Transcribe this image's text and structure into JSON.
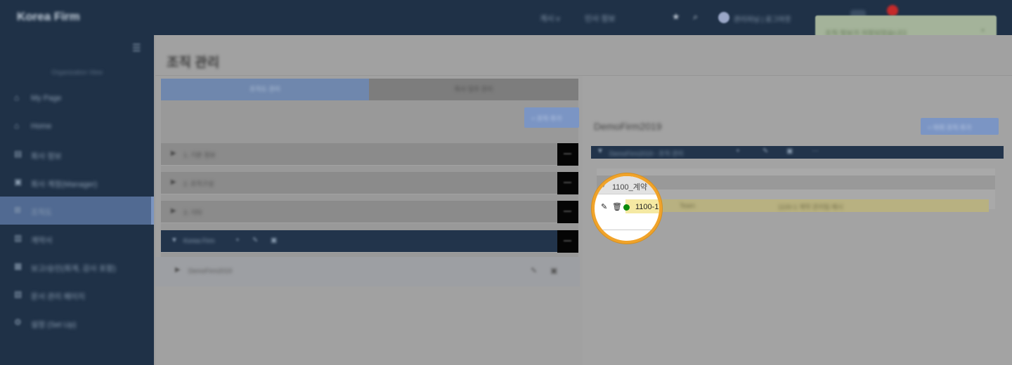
{
  "header": {
    "brand": "Korea Firm",
    "items": [
      "게시 v",
      "인사 정보"
    ],
    "user": "관리자님 | 로그아웃",
    "notification": "조직 정보가 저장되었습니다"
  },
  "sidebar": {
    "org_label": "Organization View",
    "items": [
      {
        "label": "My Page",
        "icon": "home-icon"
      },
      {
        "label": "Home",
        "icon": "home-icon"
      },
      {
        "label": "회사 정보",
        "icon": "building-icon"
      },
      {
        "label": "회사 계정(Manager)",
        "icon": "user-icon"
      },
      {
        "label": "조직도",
        "icon": "sitemap-icon",
        "active": true
      },
      {
        "label": "계약서",
        "icon": "doc-icon"
      },
      {
        "label": "보고/승인(회계, 감사 포함)",
        "icon": "check-icon"
      },
      {
        "label": "문서 관리 페이지",
        "icon": "folder-icon"
      },
      {
        "label": "설정 (Set Up)",
        "icon": "gear-icon"
      }
    ]
  },
  "main": {
    "title": "조직 관리",
    "tabs": [
      "조직도 관리",
      "회사 업무 관리"
    ],
    "add_button": "+ 조직 추가",
    "accordion": [
      "1. 기본 정보",
      "2. 조직구성",
      "3. 기타",
      "Korea Firm"
    ],
    "sub_item": "DemoFirm2019"
  },
  "detail": {
    "firm_name": "DemoFirm2019",
    "button": "+ 하위 조직 추가",
    "header_label": "DemoFirm2019 - 조직 관리",
    "sub_header": "1100_계약 관리 팀",
    "row_code": "1100-1",
    "row_status": "Team",
    "row_desc": "1100-1 계약 관리팀 예시"
  },
  "magnifier": {
    "header": "1100_계약",
    "code": "1100-1"
  },
  "colors": {
    "navy": "#1f3147",
    "highlight": "#f0a32a",
    "status_green": "#0b8a0b"
  }
}
